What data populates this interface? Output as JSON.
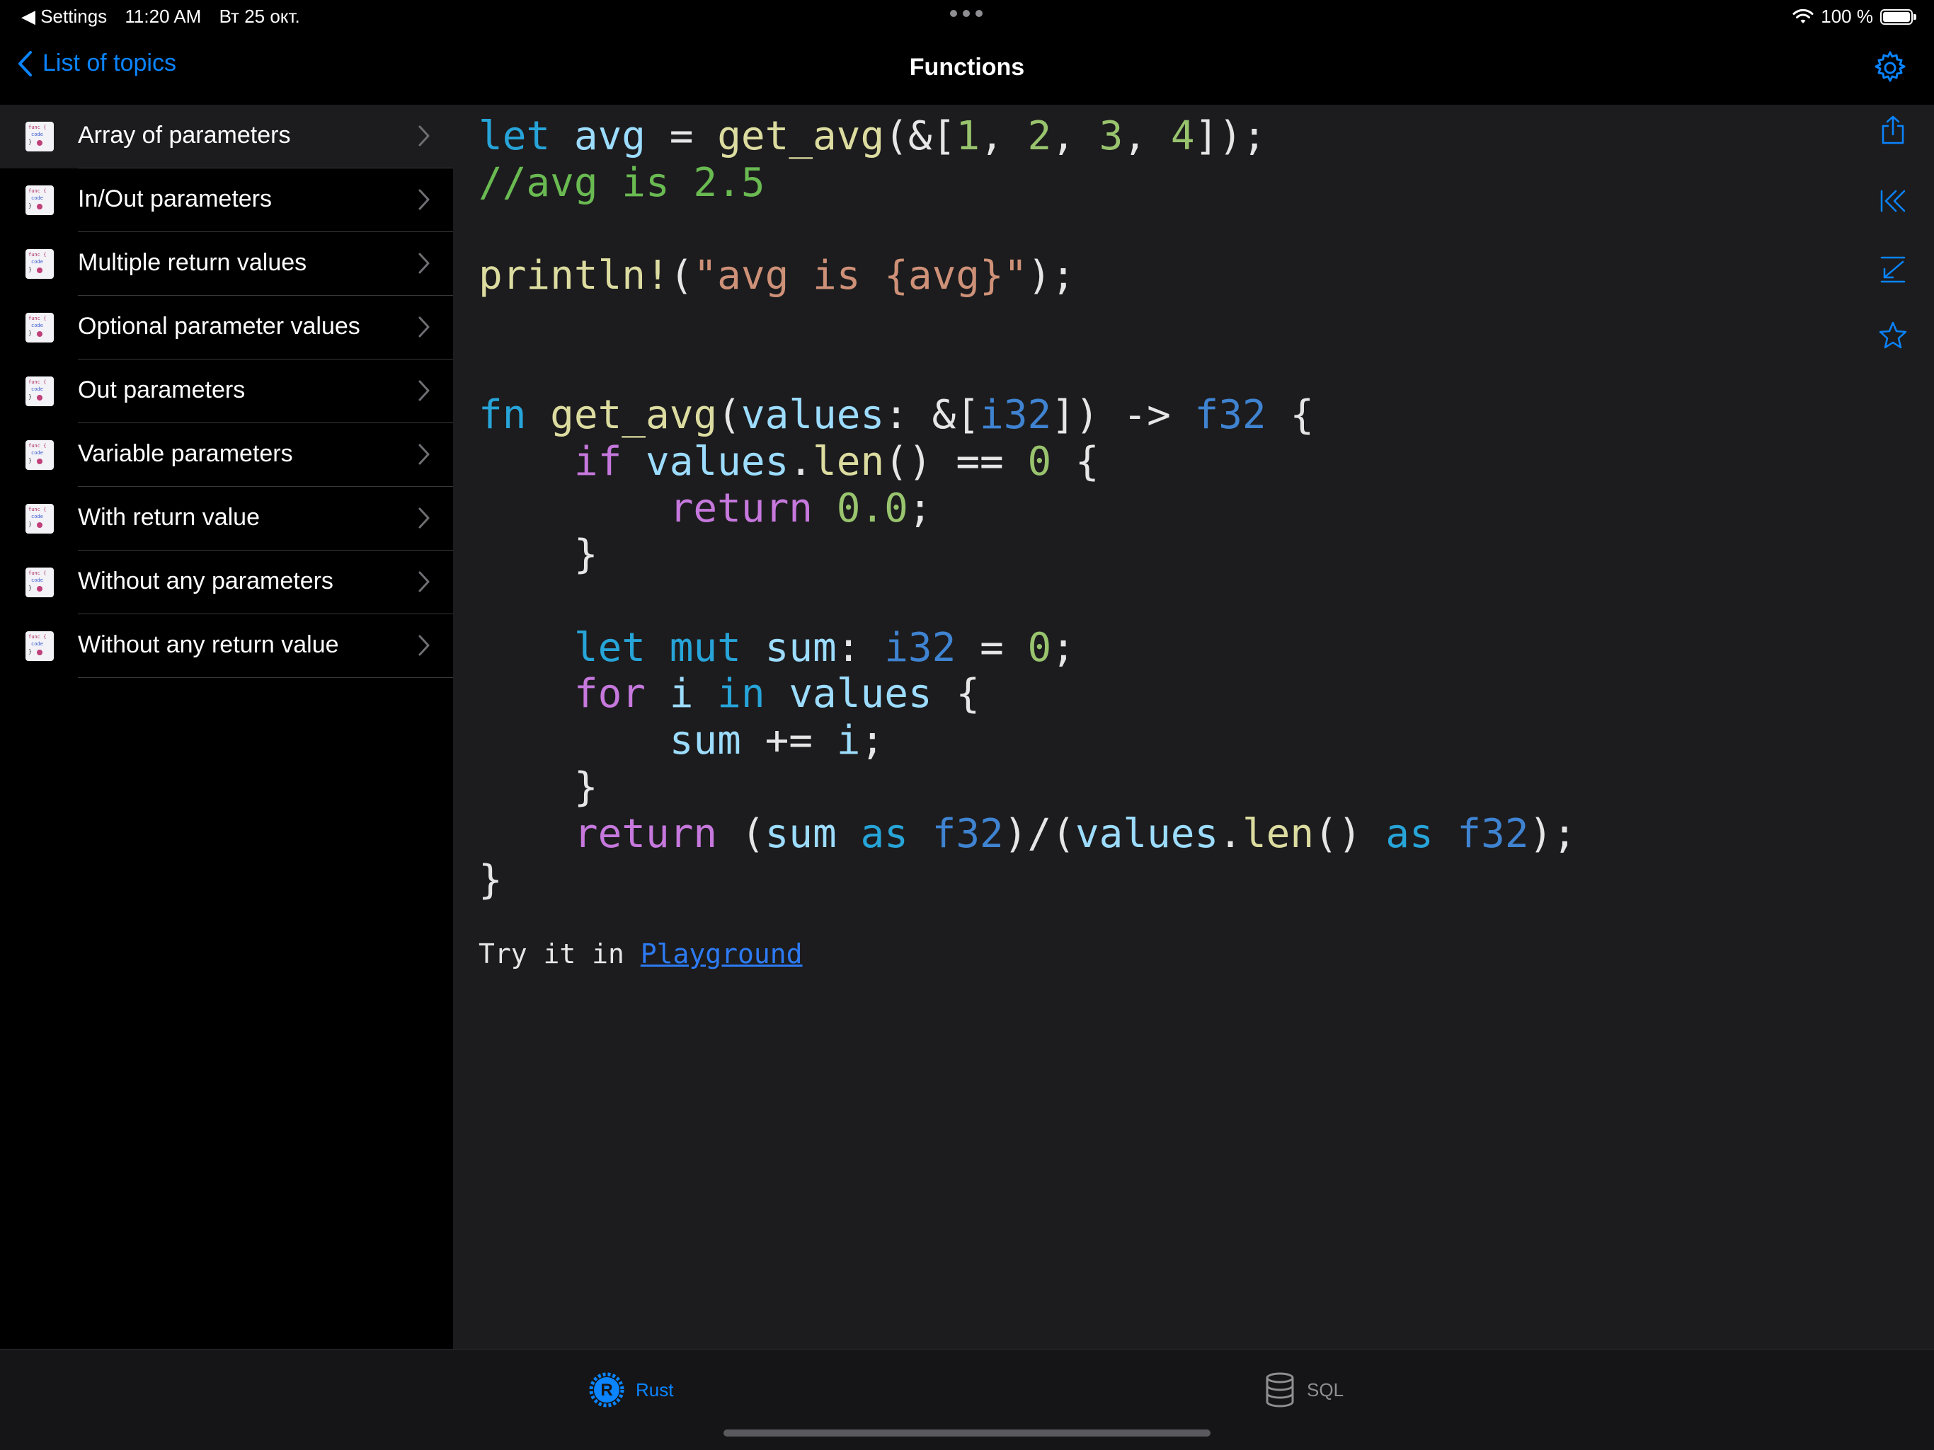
{
  "status_bar": {
    "back_app": "Settings",
    "time": "11:20 AM",
    "date": "Вт 25 окт.",
    "battery_text": "100 %",
    "battery_level": 1.0
  },
  "nav": {
    "back_label": "List of topics",
    "title": "Functions"
  },
  "sidebar": {
    "icon_caption": "func {",
    "icon_caption2": "code",
    "items": [
      {
        "label": "Array of parameters",
        "selected": true
      },
      {
        "label": "In/Out parameters",
        "selected": false
      },
      {
        "label": "Multiple return values",
        "selected": false
      },
      {
        "label": "Optional parameter values",
        "selected": false
      },
      {
        "label": "Out parameters",
        "selected": false
      },
      {
        "label": "Variable parameters",
        "selected": false
      },
      {
        "label": "With return value",
        "selected": false
      },
      {
        "label": "Without any parameters",
        "selected": false
      },
      {
        "label": "Without any return value",
        "selected": false
      }
    ]
  },
  "content": {
    "code_lines": [
      "let avg = get_avg(&[1, 2, 3, 4]);",
      "//avg is 2.5",
      "",
      "println!(\"avg is {avg}\");",
      "",
      "",
      "fn get_avg(values: &[i32]) -> f32 {",
      "    if values.len() == 0 {",
      "        return 0.0;",
      "    }",
      "",
      "    let mut sum: i32 = 0;",
      "    for i in values {",
      "        sum += i;",
      "    }",
      "    return (sum as f32)/(values.len() as f32);",
      "}"
    ],
    "try_prefix": "Try it in ",
    "playground_label": "Playground"
  },
  "toolbar": {
    "icons": [
      "share-icon",
      "first-page-icon",
      "collapse-icon",
      "star-icon"
    ]
  },
  "tabs": [
    {
      "label": "Rust",
      "icon": "rust-icon",
      "active": true
    },
    {
      "label": "SQL",
      "icon": "database-icon",
      "active": false
    }
  ],
  "colors": {
    "accent": "#0a84ff",
    "keyword": "#27a4d8",
    "control": "#c678dd",
    "function": "#dcdca0",
    "number": "#99c46e",
    "type": "#3f83d1",
    "string": "#ce9178",
    "comment": "#6aba52",
    "link": "#2d7bf4"
  }
}
